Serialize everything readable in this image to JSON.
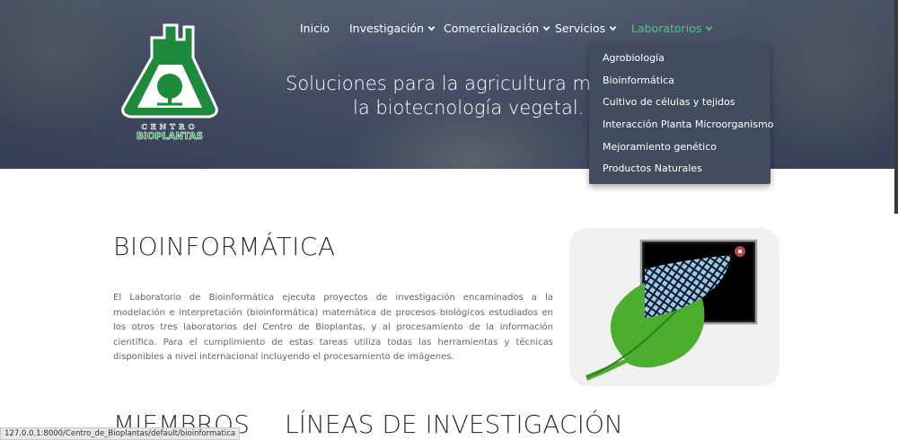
{
  "nav": {
    "items": [
      {
        "label": "Inicio",
        "has_dropdown": false
      },
      {
        "label": "Investigación",
        "has_dropdown": true
      },
      {
        "label": "Comercialización",
        "has_dropdown": true
      },
      {
        "label": "Servicios",
        "has_dropdown": true
      },
      {
        "label": "Laboratorios",
        "has_dropdown": true,
        "active": true
      }
    ]
  },
  "logo": {
    "top_text": "CENTRO",
    "bottom_text": "BIOPLANTAS"
  },
  "hero": {
    "line1": "Soluciones para la agricultura moderna",
    "line2": "la biotecnología vegetal."
  },
  "dropdown": {
    "items": [
      "Agrobiología",
      "Bioinformática",
      "Cultivo de células y tejidos",
      "Interacción Planta Microorganismo",
      "Mejoramiento genético",
      "Productos Naturales"
    ]
  },
  "main": {
    "title": "BIOINFORMÁTICA",
    "paragraph": "El Laboratorio de Bioinformática ejecuta proyectos de investigación encaminados a la modelación e interpretación (bioinformática) matemática de procesos biológicos estudiados en los otros tres laboratorios del Centro de Bioplantas, y al procesamiento de la información científica. Para el cumplimiento de estas tareas utiliza todas las herramientas y técnicas disponibles a nivel internacional incluyendo el procesamiento de imágenes."
  },
  "sections": {
    "members": "MIEMBROS",
    "research_lines": "LÍNEAS DE INVESTIGACIÓN"
  },
  "status_bar": {
    "url": "127.0.0.1:8000/Centro_de_Bioplantas/default/bioinformatica"
  },
  "colors": {
    "accent": "#3fcf7a",
    "logo_green": "#1e8a3c",
    "dropdown_bg": "#434c5f"
  }
}
